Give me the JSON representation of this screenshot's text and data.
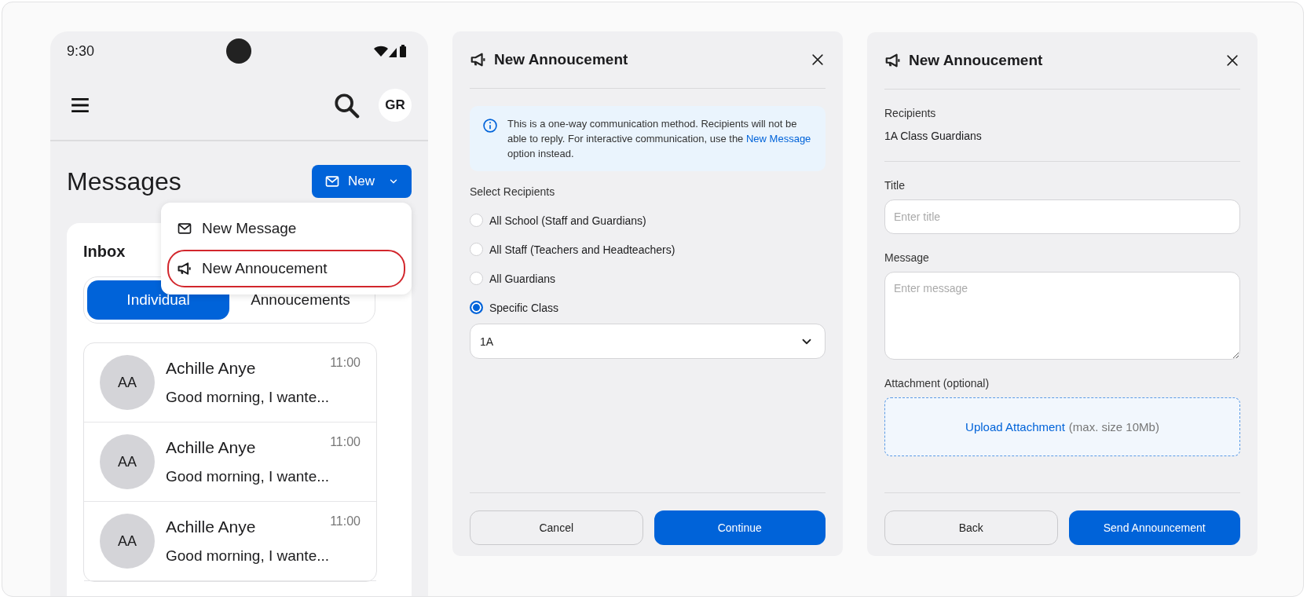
{
  "phone": {
    "status_bar": {
      "time": "9:30"
    },
    "avatar": "GR",
    "title": "Messages",
    "new_button": "New",
    "menu": [
      {
        "label": "New Message",
        "kind": "message",
        "highlighted": false
      },
      {
        "label": "New Annoucement",
        "kind": "announcement",
        "highlighted": true
      }
    ],
    "inbox": {
      "title": "Inbox",
      "tabs": [
        {
          "label": "Individual",
          "selected": true
        },
        {
          "label": "Annoucements",
          "selected": false
        }
      ],
      "messages": [
        {
          "initials": "AA",
          "name": "Achille Anye",
          "preview": "Good morning, I wante...",
          "time": "11:00"
        },
        {
          "initials": "AA",
          "name": "Achille Anye",
          "preview": "Good morning, I wante...",
          "time": "11:00"
        },
        {
          "initials": "AA",
          "name": "Achille Anye",
          "preview": "Good morning, I wante...",
          "time": "11:00"
        }
      ]
    }
  },
  "recipients_dialog": {
    "title": "New Annoucement",
    "info": {
      "text_before": "This is a one-way communication method. Recipients will not be able to reply. For interactive communication, use the ",
      "link": "New Message",
      "text_after": " option instead."
    },
    "label": "Select Recipients",
    "options": [
      {
        "label": "All School (Staff and Guardians)",
        "selected": false
      },
      {
        "label": "All Staff (Teachers and Headteachers)",
        "selected": false
      },
      {
        "label": "All Guardians",
        "selected": false
      },
      {
        "label": "Specific Class",
        "selected": true
      }
    ],
    "class_select": {
      "value": "1A"
    },
    "buttons": [
      {
        "label": "Cancel",
        "kind": "secondary"
      },
      {
        "label": "Continue",
        "kind": "primary"
      }
    ]
  },
  "compose_dialog": {
    "title": "New Annoucement",
    "recipients_label": "Recipients",
    "recipients_value": "1A Class Guardians",
    "fields": [
      {
        "label": "Title",
        "placeholder": "Enter title",
        "kind": "input"
      },
      {
        "label": "Message",
        "placeholder": "Enter message",
        "kind": "textarea"
      }
    ],
    "attachment": {
      "label": "Attachment (optional)",
      "link": "Upload Attachment",
      "note": "(max. size 10Mb)"
    },
    "buttons": [
      {
        "label": "Back",
        "kind": "secondary"
      },
      {
        "label": "Send Announcement",
        "kind": "primary"
      }
    ]
  }
}
